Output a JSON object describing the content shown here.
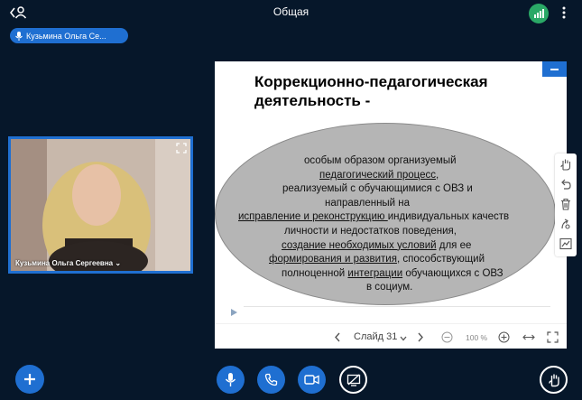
{
  "app": {
    "title": "Общая",
    "accent": "#1f6fd1",
    "background": "#06172a"
  },
  "presenter_chip": {
    "name": "Кузьмина Ольга Се..."
  },
  "webcam": {
    "name": "Кузьмина Ольга Сергеевна",
    "caret": "⌄"
  },
  "slide": {
    "title_line1": "Коррекционно-педагогическая",
    "title_line2": "деятельность -",
    "body": {
      "l1": "особым образом организуемый",
      "l2": "педагогический процесс",
      "l2_tail": ",",
      "l3": "реализуемый с обучающимися с ОВЗ и",
      "l4": "направленный на",
      "l5_u": "исправление и реконструкцию ",
      "l5_tail": "индивидуальных качеств",
      "l6": "личности и недостатков поведения,",
      "l7_u": "создание необходимых  условий",
      "l7_tail": " для ее",
      "l8_u": "формирования и развития",
      "l8_tail": ", способствующий",
      "l9_head": "полноценной ",
      "l9_u": "интеграции",
      "l9_tail": " обучающихся с ОВЗ",
      "l10": "в социум."
    }
  },
  "slide_nav": {
    "slide_label": "Слайд 31",
    "zoom": "100 %"
  },
  "icons": {
    "top": [
      "user-back-icon",
      "signal-icon",
      "kebab-icon"
    ],
    "tools": [
      "hand-icon",
      "undo-icon",
      "trash-icon",
      "multi-user-icon",
      "graph-icon"
    ],
    "bottom": [
      "plus-icon",
      "microphone-icon",
      "phone-icon",
      "camera-icon",
      "screen-share-off-icon",
      "raise-hand-icon"
    ]
  }
}
